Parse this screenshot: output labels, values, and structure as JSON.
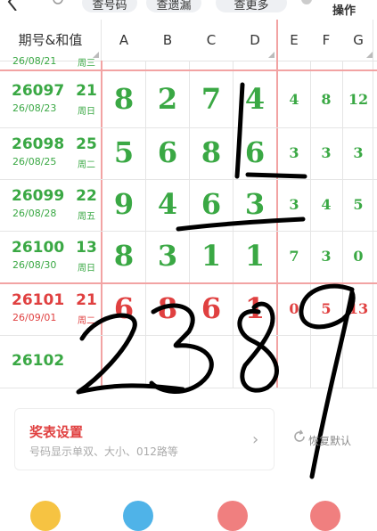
{
  "toolbar": {
    "search_tabs": [
      "查号码",
      "查遗漏",
      "查更多"
    ],
    "action_label": "操作"
  },
  "header": {
    "period_col": "期号&和值",
    "columns": [
      "A",
      "B",
      "C",
      "D",
      "E",
      "F",
      "G"
    ]
  },
  "partial_top": {
    "date": "26/08/21",
    "day": "周三"
  },
  "rows": [
    {
      "period": "26097",
      "date": "26/08/23",
      "sum": "21",
      "day": "周日",
      "main": [
        "8",
        "2",
        "7",
        "4"
      ],
      "ext": [
        "4",
        "8",
        "12"
      ],
      "highlight": false
    },
    {
      "period": "26098",
      "date": "26/08/25",
      "sum": "25",
      "day": "周二",
      "main": [
        "5",
        "6",
        "8",
        "6"
      ],
      "ext": [
        "3",
        "3",
        "3"
      ],
      "highlight": false
    },
    {
      "period": "26099",
      "date": "26/08/28",
      "sum": "22",
      "day": "周五",
      "main": [
        "9",
        "4",
        "6",
        "3"
      ],
      "ext": [
        "3",
        "4",
        "5"
      ],
      "highlight": false
    },
    {
      "period": "26100",
      "date": "26/08/30",
      "sum": "13",
      "day": "周日",
      "main": [
        "8",
        "3",
        "1",
        "1"
      ],
      "ext": [
        "7",
        "3",
        "0"
      ],
      "highlight": false
    },
    {
      "period": "26101",
      "date": "26/09/01",
      "sum": "21",
      "day": "周二",
      "main": [
        "6",
        "8",
        "6",
        "1"
      ],
      "ext": [
        "0",
        "5",
        "13"
      ],
      "highlight": true
    },
    {
      "period": "26102",
      "date": "",
      "sum": "",
      "day": "",
      "main": [
        "",
        "",
        "",
        ""
      ],
      "ext": [
        "",
        "",
        ""
      ],
      "highlight": false
    }
  ],
  "settings_card": {
    "title": "奖表设置",
    "subtitle": "号码显示单双、大小、012路等"
  },
  "restore_label": "恢复默认",
  "colors": {
    "green": "#3aa844",
    "red": "#e04040",
    "grid": "#e5e5e5",
    "red_grid": "#f2a3a3"
  }
}
